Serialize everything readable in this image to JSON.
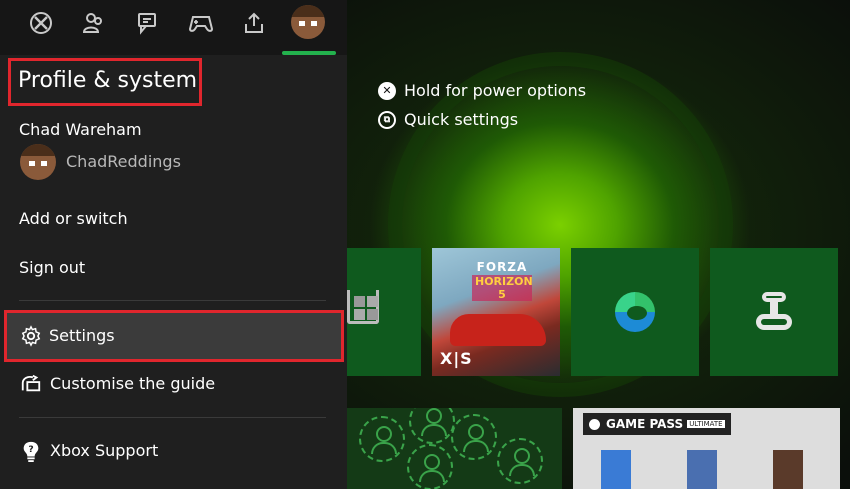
{
  "nav": {
    "tabs": [
      {
        "icon": "xbox-logo-icon"
      },
      {
        "icon": "people-icon"
      },
      {
        "icon": "chat-icon"
      },
      {
        "icon": "controller-icon"
      },
      {
        "icon": "share-upload-icon"
      },
      {
        "icon": "profile-avatar-icon"
      }
    ],
    "active_tab_color": "#23b14d"
  },
  "profile": {
    "section_title": "Profile & system",
    "user_name": "Chad Wareham",
    "gamertag": "ChadReddings"
  },
  "menu": {
    "add_or_switch": "Add or switch",
    "sign_out": "Sign out",
    "settings": "Settings",
    "customise_guide": "Customise the guide",
    "xbox_support": "Xbox Support"
  },
  "power": {
    "hold_for_power": "Hold for power options",
    "quick_settings": "Quick settings"
  },
  "tiles": {
    "forza_line1": "FORZA",
    "forza_line2": "HORIZON 5",
    "forza_platform": "X|S",
    "gamepass_label": "GAME PASS",
    "gamepass_tier": "ULTIMATE"
  },
  "colors": {
    "highlight": "#e0262d",
    "tile_green": "#0f5a1e",
    "panel_bg": "#1f1f1f"
  }
}
